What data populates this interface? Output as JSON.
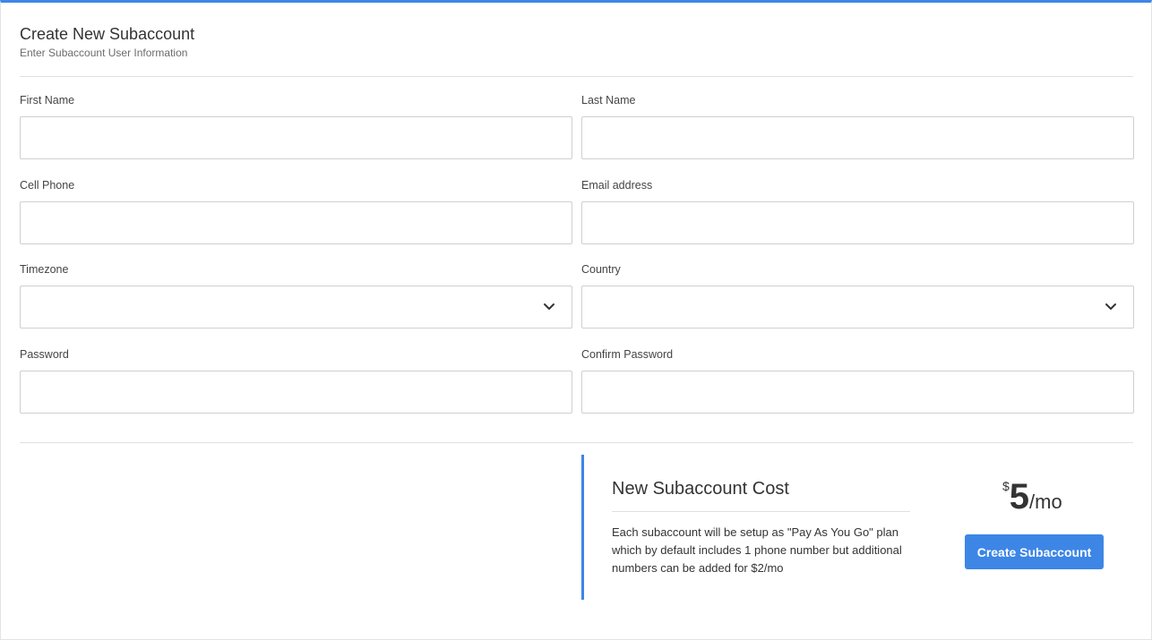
{
  "header": {
    "title": "Create New Subaccount",
    "subtitle": "Enter Subaccount User Information"
  },
  "form": {
    "first_name": {
      "label": "First Name",
      "value": ""
    },
    "last_name": {
      "label": "Last Name",
      "value": ""
    },
    "cell_phone": {
      "label": "Cell Phone",
      "value": ""
    },
    "email": {
      "label": "Email address",
      "value": ""
    },
    "timezone": {
      "label": "Timezone",
      "selected": ""
    },
    "country": {
      "label": "Country",
      "selected": ""
    },
    "password": {
      "label": "Password",
      "value": ""
    },
    "confirm_password": {
      "label": "Confirm Password",
      "value": ""
    }
  },
  "cost": {
    "title": "New Subaccount Cost",
    "description": "Each subaccount will be setup as \"Pay As You Go\" plan which by default includes 1 phone number but additional numbers can be added for $2/mo",
    "currency": "$",
    "amount": "5",
    "period": "/mo"
  },
  "actions": {
    "create_label": "Create Subaccount"
  },
  "icons": {
    "select_arrow": "chevron-down-icon"
  },
  "colors": {
    "accent": "#3d86e6"
  }
}
